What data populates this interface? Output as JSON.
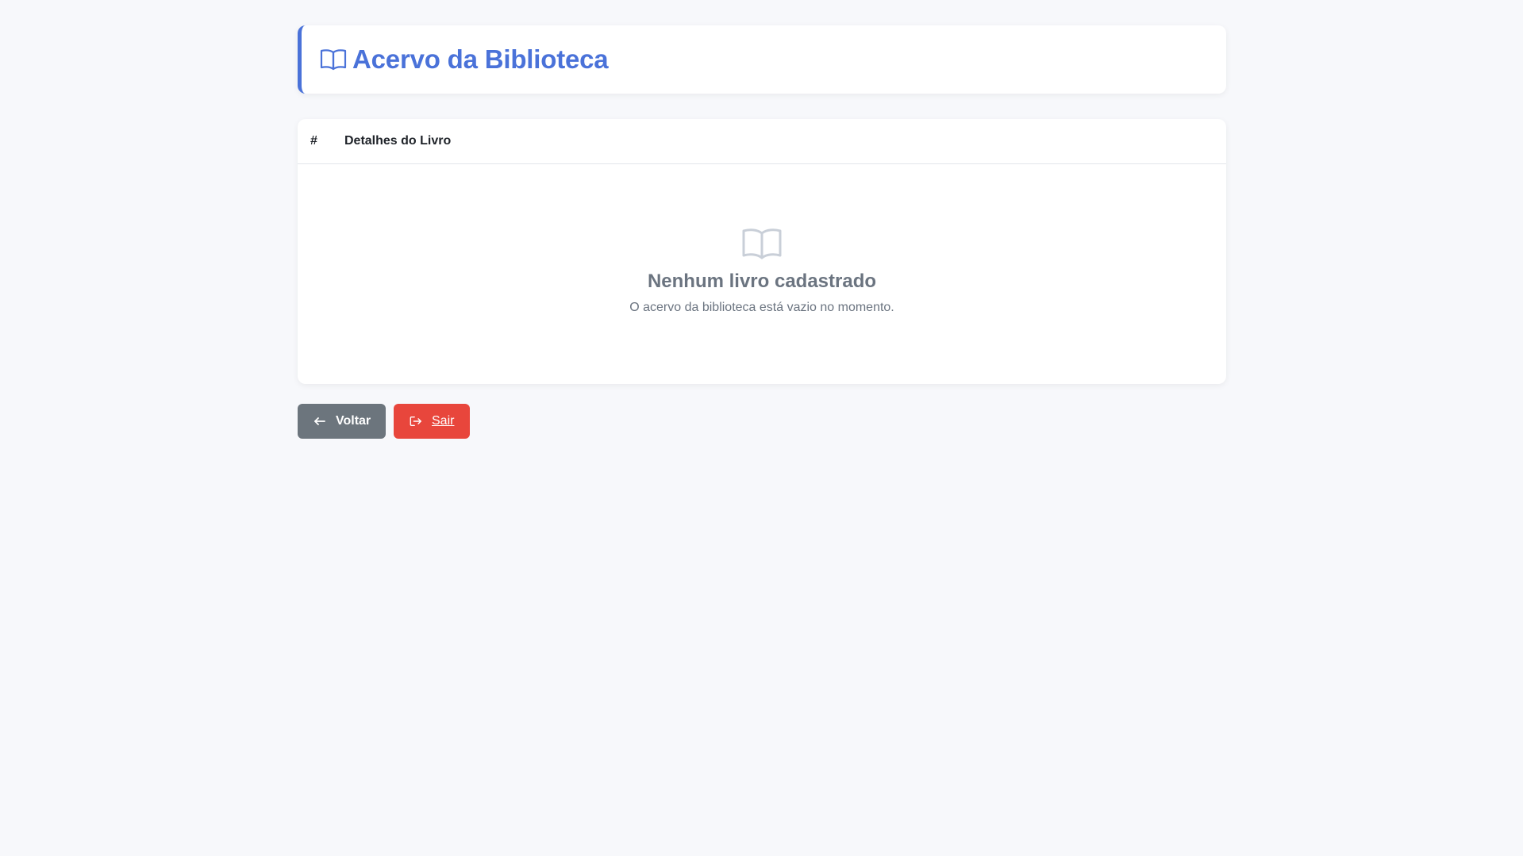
{
  "header": {
    "title": "Acervo da Biblioteca",
    "icon": "book-open-icon",
    "accent_color": "#4a72d9"
  },
  "table": {
    "columns": [
      "#",
      "Detalhes do Livro"
    ],
    "rows": [],
    "empty_state": {
      "icon": "book-open-icon",
      "title": "Nenhum livro cadastrado",
      "subtitle": "O acervo da biblioteca está vazio no momento."
    }
  },
  "actions": {
    "back_label": "Voltar",
    "back_icon": "arrow-left-icon",
    "back_color": "#6c757d",
    "exit_label": "Sair",
    "exit_icon": "sign-out-icon",
    "exit_color": "#e8463c"
  }
}
